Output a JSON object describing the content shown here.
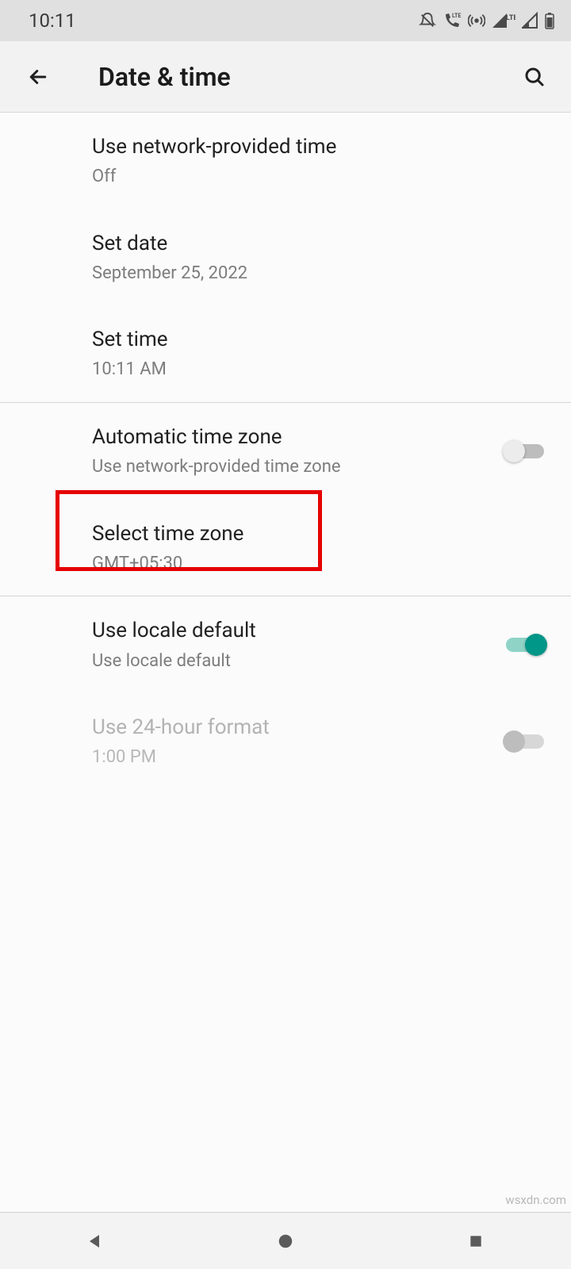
{
  "status": {
    "time": "10:11"
  },
  "header": {
    "title": "Date & time"
  },
  "items": {
    "network_time": {
      "title": "Use network-provided time",
      "sub": "Off"
    },
    "set_date": {
      "title": "Set date",
      "sub": "September 25, 2022"
    },
    "set_time": {
      "title": "Set time",
      "sub": "10:11 AM"
    },
    "auto_tz": {
      "title": "Automatic time zone",
      "sub": "Use network-provided time zone"
    },
    "select_tz": {
      "title": "Select time zone",
      "sub": "GMT+05:30"
    },
    "locale_default": {
      "title": "Use locale default",
      "sub": "Use locale default"
    },
    "hour24": {
      "title": "Use 24-hour format",
      "sub": "1:00 PM"
    }
  },
  "watermark": "wsxdn.com"
}
